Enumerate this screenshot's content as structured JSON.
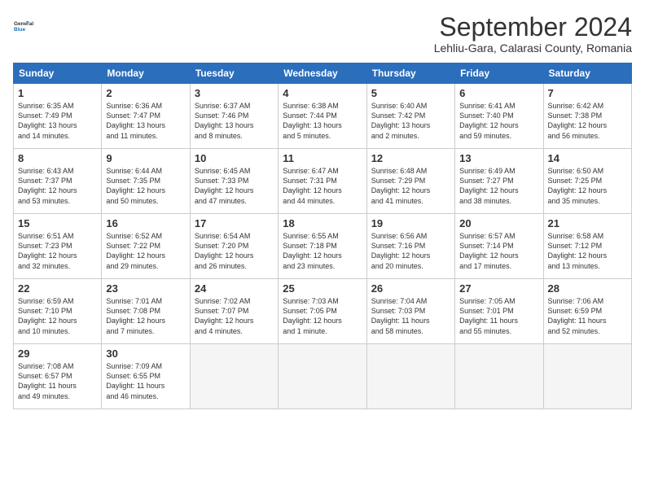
{
  "header": {
    "logo_line1": "General",
    "logo_line2": "Blue",
    "month": "September 2024",
    "location": "Lehliu-Gara, Calarasi County, Romania"
  },
  "days_of_week": [
    "Sunday",
    "Monday",
    "Tuesday",
    "Wednesday",
    "Thursday",
    "Friday",
    "Saturday"
  ],
  "weeks": [
    [
      {
        "day": "1",
        "info": "Sunrise: 6:35 AM\nSunset: 7:49 PM\nDaylight: 13 hours\nand 14 minutes."
      },
      {
        "day": "2",
        "info": "Sunrise: 6:36 AM\nSunset: 7:47 PM\nDaylight: 13 hours\nand 11 minutes."
      },
      {
        "day": "3",
        "info": "Sunrise: 6:37 AM\nSunset: 7:46 PM\nDaylight: 13 hours\nand 8 minutes."
      },
      {
        "day": "4",
        "info": "Sunrise: 6:38 AM\nSunset: 7:44 PM\nDaylight: 13 hours\nand 5 minutes."
      },
      {
        "day": "5",
        "info": "Sunrise: 6:40 AM\nSunset: 7:42 PM\nDaylight: 13 hours\nand 2 minutes."
      },
      {
        "day": "6",
        "info": "Sunrise: 6:41 AM\nSunset: 7:40 PM\nDaylight: 12 hours\nand 59 minutes."
      },
      {
        "day": "7",
        "info": "Sunrise: 6:42 AM\nSunset: 7:38 PM\nDaylight: 12 hours\nand 56 minutes."
      }
    ],
    [
      {
        "day": "8",
        "info": "Sunrise: 6:43 AM\nSunset: 7:37 PM\nDaylight: 12 hours\nand 53 minutes."
      },
      {
        "day": "9",
        "info": "Sunrise: 6:44 AM\nSunset: 7:35 PM\nDaylight: 12 hours\nand 50 minutes."
      },
      {
        "day": "10",
        "info": "Sunrise: 6:45 AM\nSunset: 7:33 PM\nDaylight: 12 hours\nand 47 minutes."
      },
      {
        "day": "11",
        "info": "Sunrise: 6:47 AM\nSunset: 7:31 PM\nDaylight: 12 hours\nand 44 minutes."
      },
      {
        "day": "12",
        "info": "Sunrise: 6:48 AM\nSunset: 7:29 PM\nDaylight: 12 hours\nand 41 minutes."
      },
      {
        "day": "13",
        "info": "Sunrise: 6:49 AM\nSunset: 7:27 PM\nDaylight: 12 hours\nand 38 minutes."
      },
      {
        "day": "14",
        "info": "Sunrise: 6:50 AM\nSunset: 7:25 PM\nDaylight: 12 hours\nand 35 minutes."
      }
    ],
    [
      {
        "day": "15",
        "info": "Sunrise: 6:51 AM\nSunset: 7:23 PM\nDaylight: 12 hours\nand 32 minutes."
      },
      {
        "day": "16",
        "info": "Sunrise: 6:52 AM\nSunset: 7:22 PM\nDaylight: 12 hours\nand 29 minutes."
      },
      {
        "day": "17",
        "info": "Sunrise: 6:54 AM\nSunset: 7:20 PM\nDaylight: 12 hours\nand 26 minutes."
      },
      {
        "day": "18",
        "info": "Sunrise: 6:55 AM\nSunset: 7:18 PM\nDaylight: 12 hours\nand 23 minutes."
      },
      {
        "day": "19",
        "info": "Sunrise: 6:56 AM\nSunset: 7:16 PM\nDaylight: 12 hours\nand 20 minutes."
      },
      {
        "day": "20",
        "info": "Sunrise: 6:57 AM\nSunset: 7:14 PM\nDaylight: 12 hours\nand 17 minutes."
      },
      {
        "day": "21",
        "info": "Sunrise: 6:58 AM\nSunset: 7:12 PM\nDaylight: 12 hours\nand 13 minutes."
      }
    ],
    [
      {
        "day": "22",
        "info": "Sunrise: 6:59 AM\nSunset: 7:10 PM\nDaylight: 12 hours\nand 10 minutes."
      },
      {
        "day": "23",
        "info": "Sunrise: 7:01 AM\nSunset: 7:08 PM\nDaylight: 12 hours\nand 7 minutes."
      },
      {
        "day": "24",
        "info": "Sunrise: 7:02 AM\nSunset: 7:07 PM\nDaylight: 12 hours\nand 4 minutes."
      },
      {
        "day": "25",
        "info": "Sunrise: 7:03 AM\nSunset: 7:05 PM\nDaylight: 12 hours\nand 1 minute."
      },
      {
        "day": "26",
        "info": "Sunrise: 7:04 AM\nSunset: 7:03 PM\nDaylight: 11 hours\nand 58 minutes."
      },
      {
        "day": "27",
        "info": "Sunrise: 7:05 AM\nSunset: 7:01 PM\nDaylight: 11 hours\nand 55 minutes."
      },
      {
        "day": "28",
        "info": "Sunrise: 7:06 AM\nSunset: 6:59 PM\nDaylight: 11 hours\nand 52 minutes."
      }
    ],
    [
      {
        "day": "29",
        "info": "Sunrise: 7:08 AM\nSunset: 6:57 PM\nDaylight: 11 hours\nand 49 minutes."
      },
      {
        "day": "30",
        "info": "Sunrise: 7:09 AM\nSunset: 6:55 PM\nDaylight: 11 hours\nand 46 minutes."
      },
      {
        "day": "",
        "info": ""
      },
      {
        "day": "",
        "info": ""
      },
      {
        "day": "",
        "info": ""
      },
      {
        "day": "",
        "info": ""
      },
      {
        "day": "",
        "info": ""
      }
    ]
  ]
}
